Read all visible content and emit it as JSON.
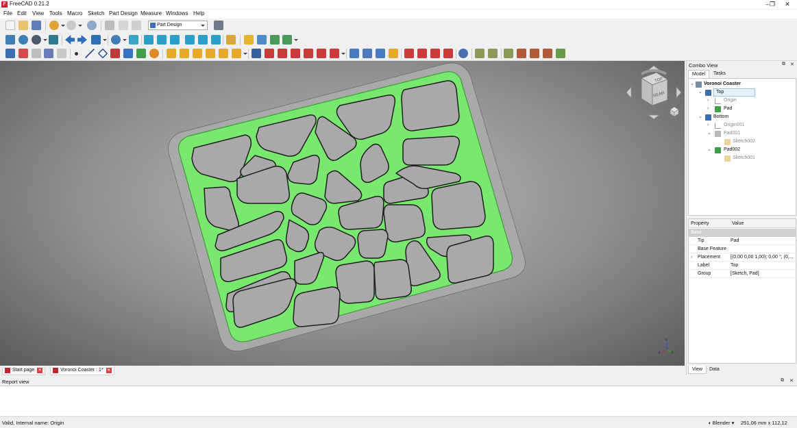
{
  "window": {
    "title": "FreeCAD 0.21.2"
  },
  "menu": {
    "items": [
      "File",
      "Edit",
      "View",
      "Tools",
      "Macro",
      "Sketch",
      "Part Design",
      "Measure",
      "Windows",
      "Help"
    ]
  },
  "toolbar": {
    "workbench": "Part Design"
  },
  "navcube": {
    "top_label": "TOP",
    "rear_label": "REAR"
  },
  "axis": {
    "x": "x",
    "y": "y",
    "z": "z"
  },
  "combo_view": {
    "title": "Combo View",
    "tabs": [
      "Model",
      "Tasks"
    ],
    "tree": [
      {
        "label": "Voronoi Coaster",
        "level": 0
      },
      {
        "label": "Top",
        "level": 1,
        "selected": true
      },
      {
        "label": "Origin",
        "level": 2,
        "grey": true
      },
      {
        "label": "Pad",
        "level": 2
      },
      {
        "label": "Bottom",
        "level": 1
      },
      {
        "label": "Origin001",
        "level": 2,
        "grey": true
      },
      {
        "label": "Pad001",
        "level": 2,
        "grey": true
      },
      {
        "label": "Sketch002",
        "level": 3,
        "grey": true
      },
      {
        "label": "Pad002",
        "level": 2
      },
      {
        "label": "Sketch001",
        "level": 3,
        "grey": true
      }
    ],
    "property_header": {
      "property": "Property",
      "value": "Value"
    },
    "property_group": "Base",
    "properties": [
      {
        "name": "Tip",
        "value": "Pad"
      },
      {
        "name": "Base Feature",
        "value": ""
      },
      {
        "name": "Placement",
        "value": "[(0,00 0,00 1,00); 0,00 °; (0,..."
      },
      {
        "name": "Label",
        "value": "Top"
      },
      {
        "name": "Group",
        "value": "[Sketch, Pad]"
      }
    ],
    "bottom_tabs": [
      "View",
      "Data"
    ]
  },
  "document_tabs": [
    "Start page",
    "Voronoi Coaster : 1*"
  ],
  "report_view": {
    "title": "Report view"
  },
  "status": {
    "message": "Valid, Internal name: Origin",
    "navigation_style": "Blender",
    "dimensions": "251,06 mm x 112,12 mm"
  },
  "colors": {
    "accent_green": "#79e86f",
    "model_grey": "#a9a9a9",
    "selection_blue": "#99c9ef"
  }
}
